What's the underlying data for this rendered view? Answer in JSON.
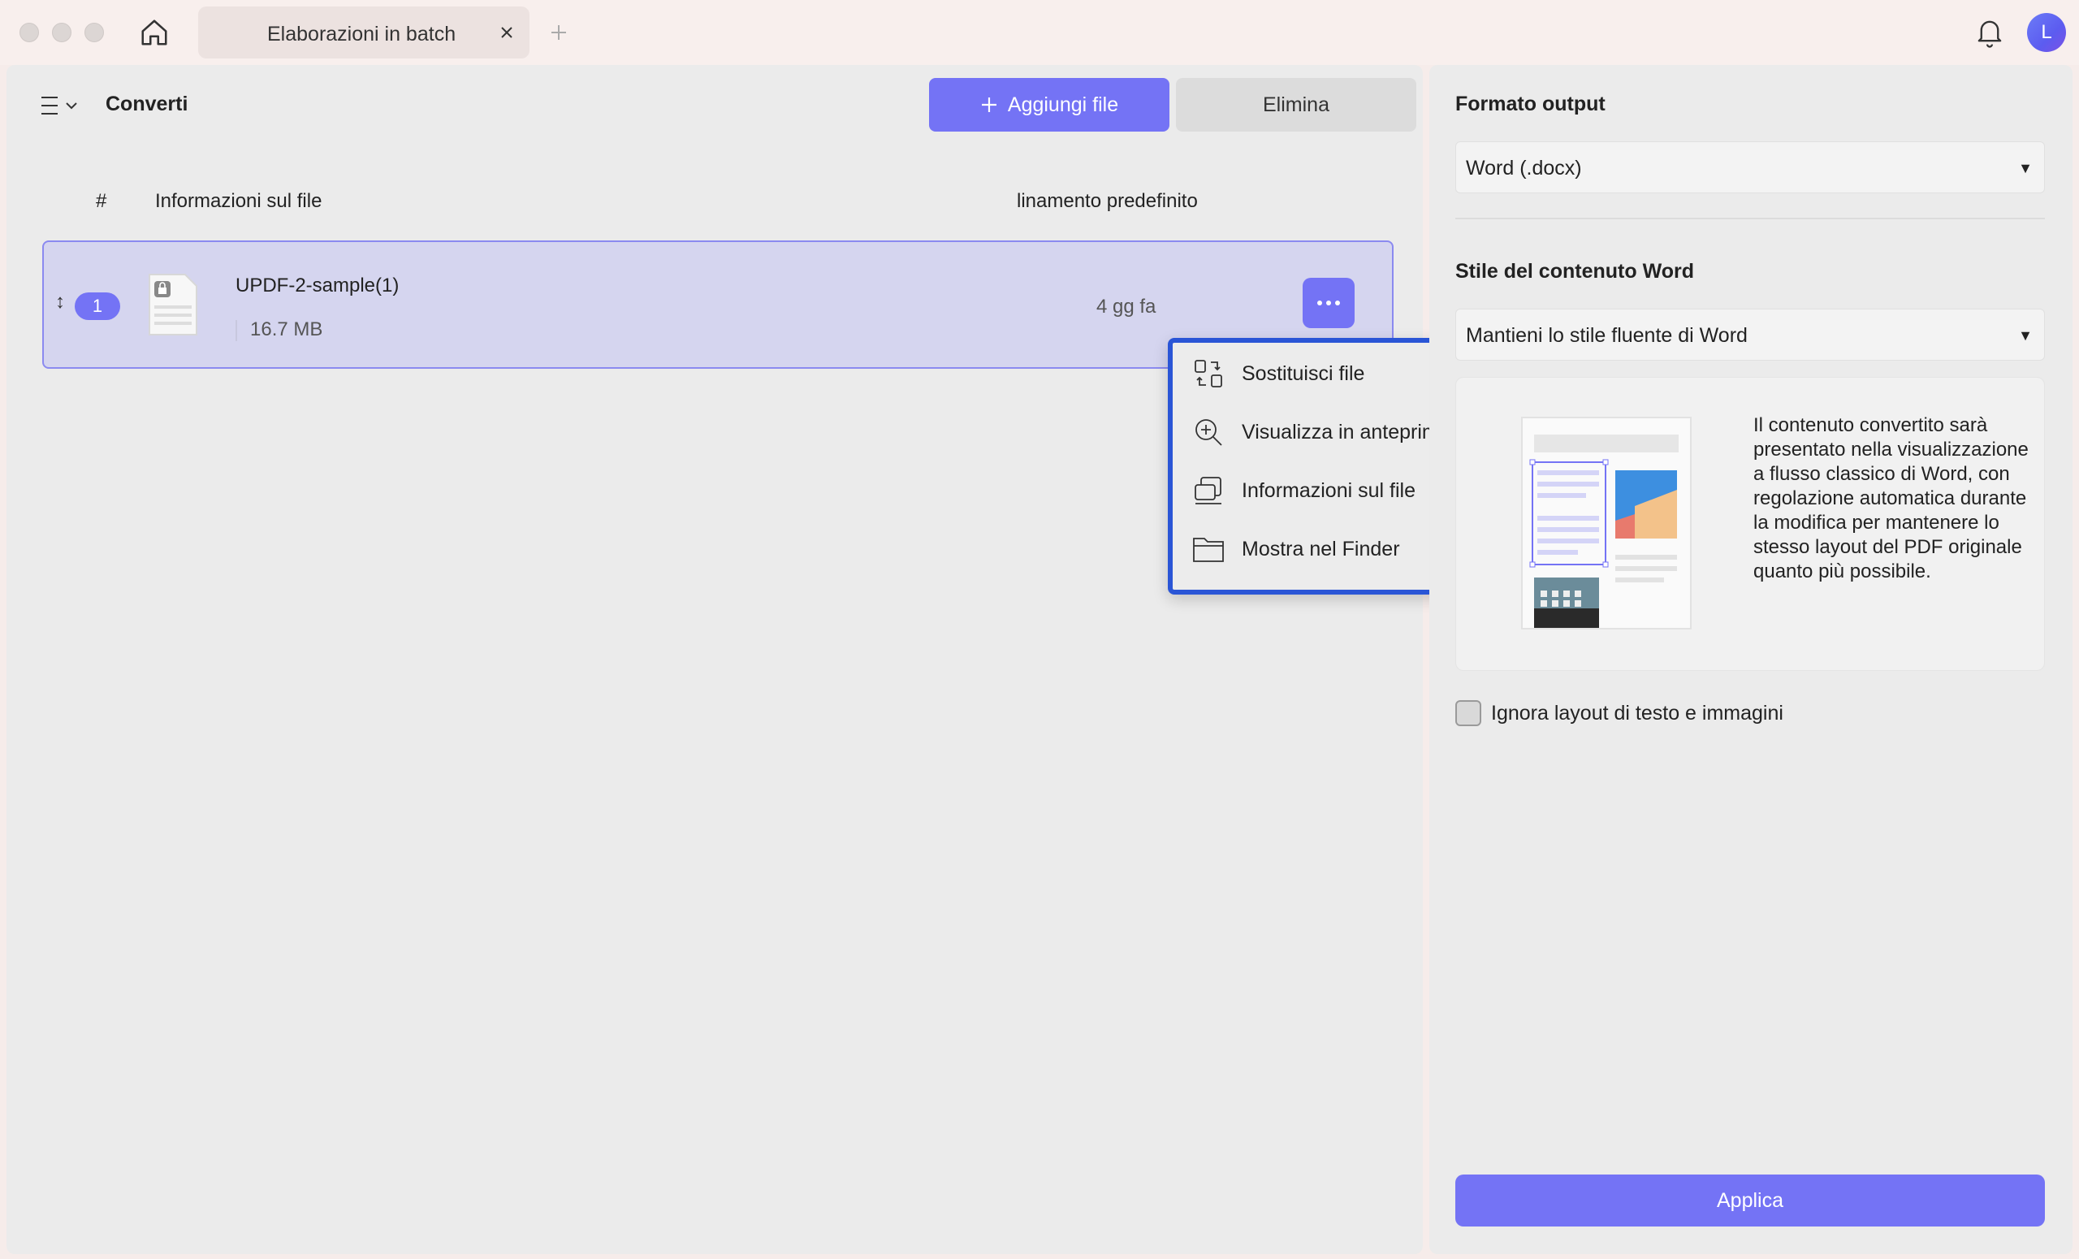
{
  "titlebar": {
    "tab_label": "Elaborazioni in batch",
    "avatar_initial": "L"
  },
  "left_panel": {
    "title": "Converti",
    "add_button_label": "Aggiungi file",
    "delete_button_label": "Elimina",
    "columns": {
      "index": "#",
      "info": "Informazioni sul file",
      "date": "linamento predefinito"
    },
    "files": [
      {
        "index": "1",
        "name": "UPDF-2-sample(1)",
        "size": "16.7 MB",
        "date": "4 gg fa"
      }
    ]
  },
  "context_menu": {
    "items": [
      {
        "label": "Sostituisci file",
        "icon": "swap-icon"
      },
      {
        "label": "Visualizza in anteprima",
        "icon": "zoom-in-icon"
      },
      {
        "label": "Informazioni sul file",
        "icon": "file-info-icon"
      },
      {
        "label": "Mostra nel Finder",
        "icon": "folder-icon"
      }
    ]
  },
  "right_panel": {
    "output_format_title": "Formato output",
    "output_format_value": "Word (.docx)",
    "word_style_title": "Stile del contenuto Word",
    "word_style_value": "Mantieni lo stile fluente di Word",
    "description": "Il contenuto convertito sarà presentato nella visualizzazione a flusso classico di Word, con regolazione automatica durante la modifica per mantenere lo stesso layout del PDF originale quanto più possibile.",
    "ignore_layout_label": "Ignora layout di testo e immagini",
    "ignore_layout_checked": false,
    "apply_button_label": "Applica"
  },
  "colors": {
    "accent": "#7473f5",
    "selection_border": "#2a55d6",
    "row_highlight": "#d5d5ef"
  }
}
